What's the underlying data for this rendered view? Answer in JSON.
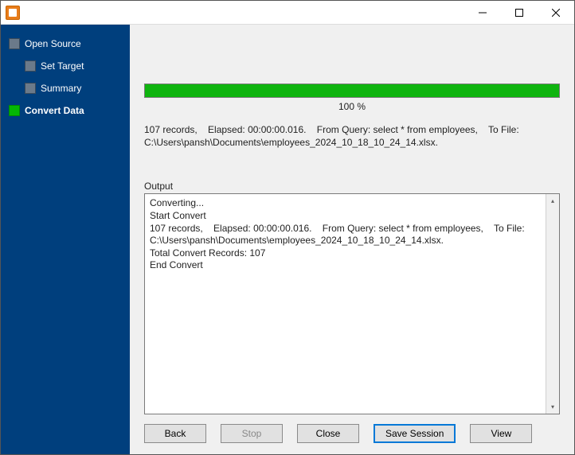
{
  "window": {
    "title": ""
  },
  "sidebar": {
    "items": [
      {
        "label": "Open Source",
        "indent": 0,
        "active": false
      },
      {
        "label": "Set Target",
        "indent": 1,
        "active": false
      },
      {
        "label": "Summary",
        "indent": 1,
        "active": false
      },
      {
        "label": "Convert Data",
        "indent": 0,
        "active": true
      }
    ]
  },
  "progress": {
    "percent_label": "100 %"
  },
  "summary": "107 records,    Elapsed: 00:00:00.016.    From Query: select * from employees,    To File: C:\\Users\\pansh\\Documents\\employees_2024_10_18_10_24_14.xlsx.",
  "output_label": "Output",
  "output": "Converting...\nStart Convert\n107 records,    Elapsed: 00:00:00.016.    From Query: select * from employees,    To File: C:\\Users\\pansh\\Documents\\employees_2024_10_18_10_24_14.xlsx.\nTotal Convert Records: 107\nEnd Convert",
  "buttons": {
    "back": "Back",
    "stop": "Stop",
    "close": "Close",
    "save_session": "Save Session",
    "view": "View"
  }
}
